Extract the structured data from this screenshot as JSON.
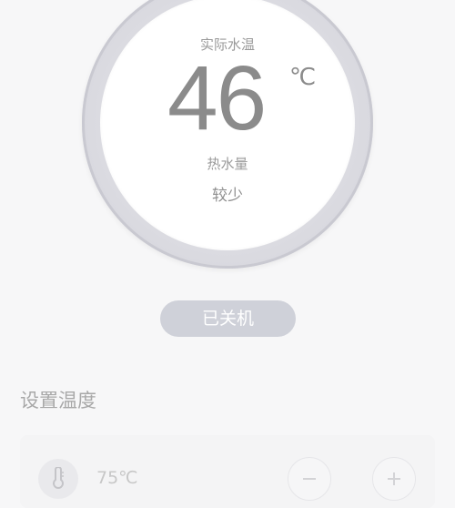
{
  "gauge": {
    "actual_label": "实际水温",
    "temperature": "46",
    "unit": "℃",
    "water_label": "热水量",
    "water_value": "较少"
  },
  "power": {
    "label": "已关机"
  },
  "settings": {
    "title": "设置温度",
    "set_temperature": "75℃",
    "icons": [
      "thermometer-icon",
      "minus-icon",
      "plus-icon"
    ]
  }
}
